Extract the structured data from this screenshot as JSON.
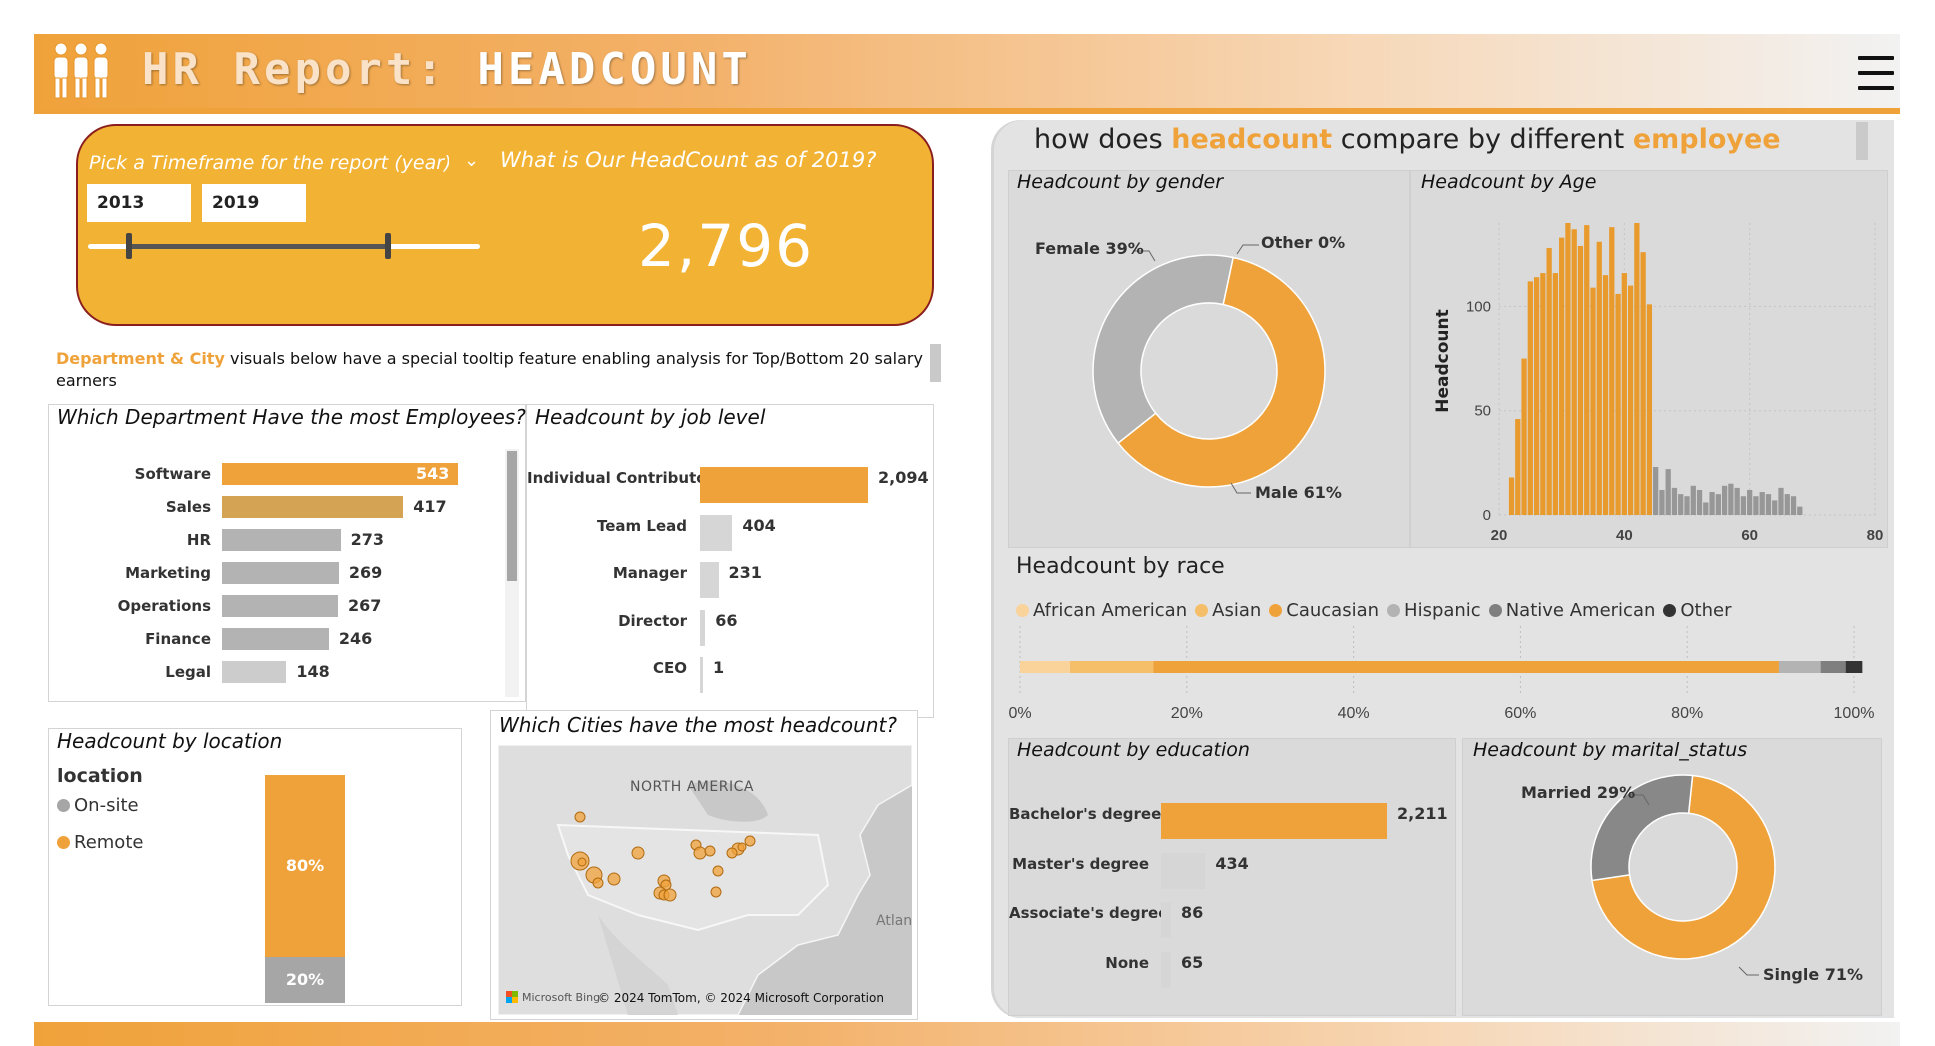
{
  "header": {
    "title_prefix": "HR Report: ",
    "title_main": "HEADCOUNT",
    "icon": "people-icon",
    "menu_icon": "hamburger-menu-icon"
  },
  "colors": {
    "accent": "#f0a23a",
    "accent_dark": "#d4a353",
    "card": "#f2b233",
    "gray": "#b3b3b3",
    "light_gray": "#d6d6d6"
  },
  "timeframe": {
    "label": "Pick a Timeframe for the report (year)",
    "start": "2013",
    "end": "2019",
    "question": "What is Our HeadCount as of 2019?",
    "headcount": "2,796"
  },
  "note": {
    "highlight": "Department & City",
    "text": " visuals below have a special tooltip feature enabling analysis for Top/Bottom 20 salary earners"
  },
  "department": {
    "title": "Which Department Have the most Employees?",
    "bars": [
      {
        "label": "Software",
        "value": 543,
        "display": "543",
        "color": "#f0a23a"
      },
      {
        "label": "Sales",
        "value": 417,
        "display": "417",
        "color": "#d4a353"
      },
      {
        "label": "HR",
        "value": 273,
        "display": "273",
        "color": "#b3b3b3"
      },
      {
        "label": "Marketing",
        "value": 269,
        "display": "269",
        "color": "#b3b3b3"
      },
      {
        "label": "Operations",
        "value": 267,
        "display": "267",
        "color": "#b3b3b3"
      },
      {
        "label": "Finance",
        "value": 246,
        "display": "246",
        "color": "#b3b3b3"
      },
      {
        "label": "Legal",
        "value": 148,
        "display": "148",
        "color": "#cccccc"
      }
    ]
  },
  "job_level": {
    "title": "Headcount by job level",
    "bars": [
      {
        "label": "Individual Contributor",
        "value": 2094,
        "display": "2,094",
        "color": "#f0a23a"
      },
      {
        "label": "Team Lead",
        "value": 404,
        "display": "404",
        "color": "#d6d6d6"
      },
      {
        "label": "Manager",
        "value": 231,
        "display": "231",
        "color": "#d6d6d6"
      },
      {
        "label": "Director",
        "value": 66,
        "display": "66",
        "color": "#d6d6d6"
      },
      {
        "label": "CEO",
        "value": 1,
        "display": "1",
        "color": "#d6d6d6"
      }
    ]
  },
  "location": {
    "title": "Headcount by location",
    "legend_title": "location",
    "legend": [
      {
        "label": "On-site",
        "color": "#a6a6a6"
      },
      {
        "label": "Remote",
        "color": "#f0a23a"
      }
    ],
    "segments": [
      {
        "label": "Remote",
        "pct": 80,
        "display": "80%",
        "color": "#f0a23a"
      },
      {
        "label": "On-site",
        "pct": 20,
        "display": "20%",
        "color": "#a6a6a6"
      }
    ]
  },
  "cities": {
    "title": "Which Cities have the most headcount?",
    "map_label": "NORTH AMERICA",
    "ocean_label": "Atlan",
    "bing_label": "Microsoft Bing",
    "copyright": "© 2024 TomTom, © 2024 Microsoft Corporation"
  },
  "compare": {
    "title_pre": "how does ",
    "title_hl1": "headcount",
    "title_mid": " compare by different ",
    "title_hl2": "employee"
  },
  "gender": {
    "title": "Headcount by gender",
    "labels": {
      "female": "Female 39%",
      "other": "Other 0%",
      "male": "Male 61%"
    }
  },
  "age": {
    "title": "Headcount by Age",
    "ylabel": "Headcount",
    "yticks": [
      "0",
      "50",
      "100"
    ],
    "xticks": [
      "20",
      "40",
      "60",
      "80"
    ]
  },
  "race": {
    "title": "Headcount by race",
    "legend": [
      {
        "label": "African American",
        "color": "#f9d39a"
      },
      {
        "label": "Asian",
        "color": "#f5bf6a"
      },
      {
        "label": "Caucasian",
        "color": "#f0a23a"
      },
      {
        "label": "Hispanic",
        "color": "#b3b3b3"
      },
      {
        "label": "Native American",
        "color": "#7f7f7f"
      },
      {
        "label": "Other",
        "color": "#333333"
      }
    ],
    "xticks": [
      "0%",
      "20%",
      "40%",
      "60%",
      "80%",
      "100%"
    ]
  },
  "education": {
    "title": "Headcount by education",
    "bars": [
      {
        "label": "Bachelor's degree",
        "value": 2211,
        "display": "2,211",
        "color": "#f0a23a"
      },
      {
        "label": "Master's degree",
        "value": 434,
        "display": "434",
        "color": "#d6d6d6"
      },
      {
        "label": "Associate's degree",
        "value": 86,
        "display": "86",
        "color": "#d6d6d6"
      },
      {
        "label": "None",
        "value": 65,
        "display": "65",
        "color": "#d6d6d6"
      }
    ]
  },
  "marital": {
    "title": "Headcount by marital_status",
    "labels": {
      "married": "Married 29%",
      "single": "Single 71%"
    }
  },
  "chart_data": [
    {
      "type": "bar",
      "title": "Which Department Have the most Employees?",
      "categories": [
        "Software",
        "Sales",
        "HR",
        "Marketing",
        "Operations",
        "Finance",
        "Legal"
      ],
      "values": [
        543,
        417,
        273,
        269,
        267,
        246,
        148
      ]
    },
    {
      "type": "bar",
      "title": "Headcount by job level",
      "categories": [
        "Individual Contributor",
        "Team Lead",
        "Manager",
        "Director",
        "CEO"
      ],
      "values": [
        2094,
        404,
        231,
        66,
        1
      ]
    },
    {
      "type": "bar",
      "title": "Headcount by location",
      "categories": [
        "Remote",
        "On-site"
      ],
      "values": [
        80,
        20
      ]
    },
    {
      "type": "pie",
      "title": "Headcount by gender",
      "categories": [
        "Male",
        "Female",
        "Other"
      ],
      "values": [
        61,
        39,
        0
      ]
    },
    {
      "type": "bar",
      "title": "Headcount by Age",
      "xlabel": "",
      "ylabel": "Headcount",
      "xlim": [
        20,
        80
      ],
      "ylim": [
        0,
        140
      ],
      "x": [
        22,
        23,
        24,
        25,
        26,
        27,
        28,
        29,
        30,
        31,
        32,
        33,
        34,
        35,
        36,
        37,
        38,
        39,
        40,
        41,
        42,
        43,
        44,
        45,
        46,
        47,
        48,
        49,
        50,
        51,
        52,
        53,
        54,
        55,
        56,
        57,
        58,
        59,
        60,
        61,
        62,
        63,
        64,
        65,
        66,
        67,
        68
      ],
      "values": [
        18,
        46,
        75,
        112,
        114,
        116,
        128,
        116,
        133,
        140,
        137,
        129,
        139,
        109,
        131,
        115,
        138,
        106,
        116,
        110,
        140,
        126,
        101,
        23,
        12,
        22,
        13,
        10,
        9,
        14,
        12,
        6,
        11,
        10,
        14,
        15,
        13,
        9,
        12,
        9,
        11,
        10,
        7,
        13,
        10,
        9,
        4
      ]
    },
    {
      "type": "bar",
      "title": "Headcount by race",
      "categories": [
        "African American",
        "Asian",
        "Caucasian",
        "Hispanic",
        "Native American",
        "Other"
      ],
      "values": [
        6,
        10,
        75,
        5,
        3,
        2
      ],
      "xlim": [
        0,
        100
      ]
    },
    {
      "type": "bar",
      "title": "Headcount by education",
      "categories": [
        "Bachelor's degree",
        "Master's degree",
        "Associate's degree",
        "None"
      ],
      "values": [
        2211,
        434,
        86,
        65
      ]
    },
    {
      "type": "pie",
      "title": "Headcount by marital_status",
      "categories": [
        "Single",
        "Married"
      ],
      "values": [
        71,
        29
      ]
    }
  ]
}
